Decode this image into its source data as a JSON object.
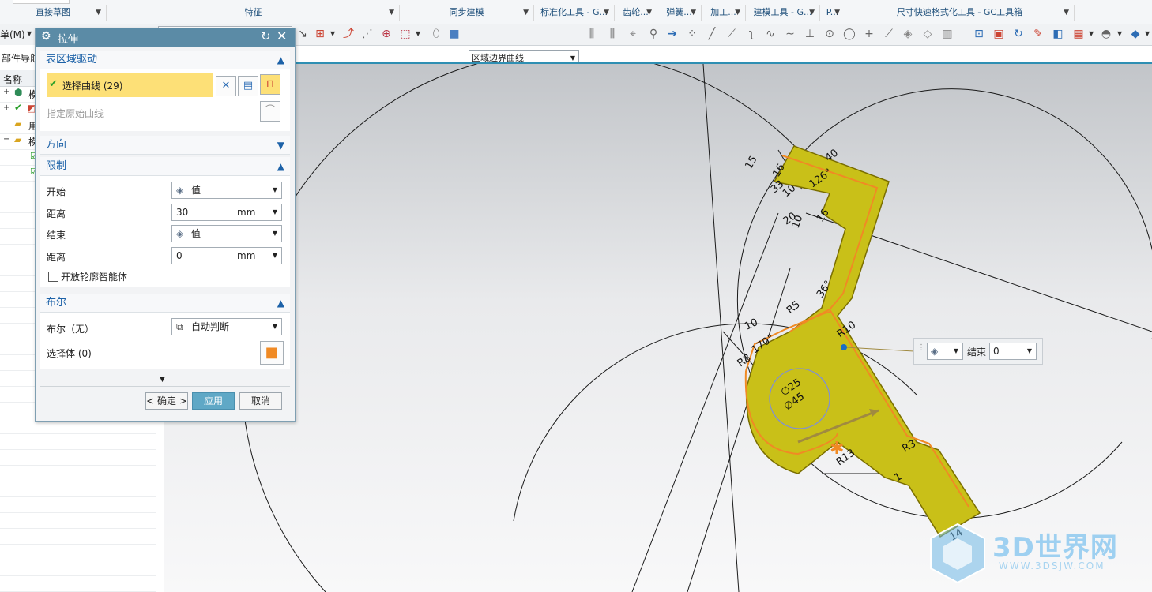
{
  "ribbon": {
    "groups": [
      {
        "label": "直接草图"
      },
      {
        "label": "特征"
      },
      {
        "label": "同步建模"
      },
      {
        "label": "标准化工具 - G..."
      },
      {
        "label": "齿轮..."
      },
      {
        "label": "弹簧..."
      },
      {
        "label": "加工..."
      },
      {
        "label": "建模工具 - G..."
      },
      {
        "label": "P..."
      },
      {
        "label": "尺寸快速格式化工具 - GC工具箱"
      }
    ]
  },
  "toolbar": {
    "menu_label": "单(M)",
    "curve_rule": "区域边界曲线"
  },
  "navigator": {
    "title": "部件导航",
    "column": "名称",
    "rows": [
      "模",
      "",
      "用",
      "模",
      "",
      ""
    ]
  },
  "dialog": {
    "title": "拉伸",
    "section_region": "表区域驱动",
    "select_curve": "选择曲线 (29)",
    "specify_original": "指定原始曲线",
    "section_direction": "方向",
    "section_limits": "限制",
    "start_label": "开始",
    "start_value": "值",
    "start_distance_label": "距离",
    "start_distance": "30",
    "start_unit": "mm",
    "end_label": "结束",
    "end_value": "值",
    "end_distance_label": "距离",
    "end_distance": "0",
    "end_unit": "mm",
    "open_profile": "开放轮廓智能体",
    "section_boolean": "布尔",
    "boolean_label": "布尔（无）",
    "boolean_value": "自动判断",
    "select_body": "选择体 (0)",
    "ok": "< 确定 >",
    "apply": "应用",
    "cancel": "取消"
  },
  "floating_input": {
    "label": "结束",
    "value": "0"
  },
  "dimensions": [
    "15",
    "16",
    "40",
    "126°",
    "33",
    "10",
    "10",
    "20",
    "16",
    "36°",
    "R5",
    "R10",
    "10",
    "170°",
    "R8",
    "∅25",
    "∅45",
    "R13",
    "R3",
    "1",
    "14"
  ],
  "watermark": {
    "brand": "3D世界网",
    "url": "WWW.3DSJW.COM"
  },
  "colors": {
    "accent": "#5b8ba6",
    "selection": "#fde077",
    "part": "#c9c018",
    "apply_button": "#5fa8c6"
  }
}
